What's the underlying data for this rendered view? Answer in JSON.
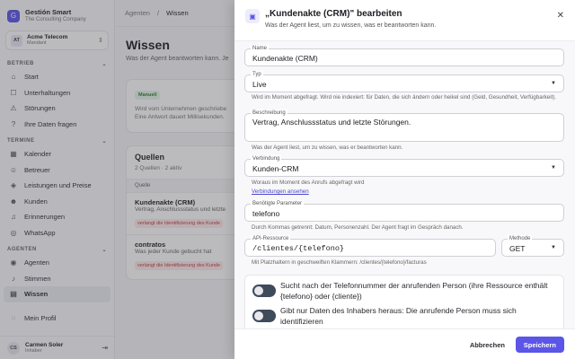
{
  "brand": {
    "logo": "G",
    "name": "Gestión Smart",
    "sub": "The Consulting Company"
  },
  "tenant": {
    "initials": "AT",
    "name": "Acme Telecom",
    "sub": "Mandant"
  },
  "sidebar": {
    "sections": [
      {
        "label": "BETRIEB",
        "items": [
          {
            "label": "Start",
            "icon": "home-icon",
            "glyph": "⌂"
          },
          {
            "label": "Unterhaltungen",
            "icon": "chat-icon",
            "glyph": "☐"
          },
          {
            "label": "Störungen",
            "icon": "alert-icon",
            "glyph": "⚠"
          },
          {
            "label": "Ihre Daten fragen",
            "icon": "question-icon",
            "glyph": "?"
          }
        ]
      },
      {
        "label": "TERMINE",
        "items": [
          {
            "label": "Kalender",
            "icon": "calendar-icon",
            "glyph": "▦"
          },
          {
            "label": "Betreuer",
            "icon": "user-icon",
            "glyph": "☺"
          },
          {
            "label": "Leistungen und Preise",
            "icon": "tag-icon",
            "glyph": "◈"
          },
          {
            "label": "Kunden",
            "icon": "users-icon",
            "glyph": "☻"
          },
          {
            "label": "Erinnerungen",
            "icon": "bell-icon",
            "glyph": "♫"
          },
          {
            "label": "WhatsApp",
            "icon": "whatsapp-icon",
            "glyph": "◎"
          }
        ]
      },
      {
        "label": "AGENTEN",
        "items": [
          {
            "label": "Agenten",
            "icon": "bot-icon",
            "glyph": "◉"
          },
          {
            "label": "Stimmen",
            "icon": "mic-icon",
            "glyph": "♪"
          },
          {
            "label": "Wissen",
            "icon": "book-icon",
            "glyph": "▤"
          }
        ]
      }
    ],
    "profile": {
      "label": "Mein Profil",
      "icon": "profile-icon",
      "glyph": "◌"
    }
  },
  "user": {
    "initials": "CS",
    "name": "Carmen Soler",
    "role": "Inhaber"
  },
  "breadcrumb": {
    "parent": "Agenten",
    "sep": "/",
    "current": "Wissen"
  },
  "page": {
    "title": "Wissen",
    "subtitle": "Was der Agent beantworten kann. Je"
  },
  "manual_card": {
    "badge": "Manuell",
    "text": "Wird vom Unternehmen geschriebe Eine Antwort dauert Millisekunden."
  },
  "sources": {
    "title": "Quellen",
    "count": "2 Quellen · 2 aktiv",
    "column": "Quelle",
    "rows": [
      {
        "title": "Kundenakte (CRM)",
        "sub": "Vertrag, Anschlussstatus und letzte",
        "warn": "verlangt die Identifizierung des Kunde"
      },
      {
        "title": "contratos",
        "sub": "Was jeder Kunde gebucht hat",
        "warn": "verlangt die Identifizierung des Kunde"
      }
    ]
  },
  "drawer": {
    "icon": "▣",
    "title": "„Kundenakte (CRM)\" bearbeiten",
    "subtitle": "Was der Agent liest, um zu wissen, was er beantworten kann.",
    "fields": {
      "name": {
        "label": "Name",
        "value": "Kundenakte (CRM)"
      },
      "type": {
        "label": "Typ",
        "value": "Live",
        "help": "Wird im Moment abgefragt. Wird nie indexiert: für Daten, die sich ändern oder heikel sind (Geld, Gesundheit, Verfügbarkeit)."
      },
      "description": {
        "label": "Beschreibung",
        "value": "Vertrag, Anschlussstatus und letzte Störungen.",
        "help": "Was der Agent liest, um zu wissen, was er beantworten kann."
      },
      "connection": {
        "label": "Verbindung",
        "value": "Kunden-CRM",
        "help": "Woraus im Moment des Anrufs abgefragt wird",
        "link": "Verbindungen ansehen"
      },
      "params": {
        "label": "Benötigte Parameter",
        "value": "telefono",
        "help": "Durch Kommas getrennt: Datum, Personenzahl. Der Agent fragt im Gespräch danach."
      },
      "resource": {
        "label": "API-Ressource",
        "value": "/clientes/{telefono}",
        "help": "Mit Platzhaltern in geschweiften Klammern: /clientes/{telefono}/facturas"
      },
      "method": {
        "label": "Methode",
        "value": "GET"
      }
    },
    "toggles": [
      {
        "text": "Sucht nach der Telefonnummer der anrufenden Person (ihre Ressource enthält {telefono} oder {cliente})",
        "on": false
      },
      {
        "text": "Gibt nur Daten des Inhabers heraus: Die anrufende Person muss sich identifizieren",
        "on": false
      }
    ],
    "cancel": "Abbrechen",
    "save": "Speichern"
  },
  "colors": {
    "accent": "#5b55e8",
    "warn_bg": "#fdeaea",
    "warn_text": "#c23b3b",
    "manual_bg": "#e7f5e9"
  }
}
